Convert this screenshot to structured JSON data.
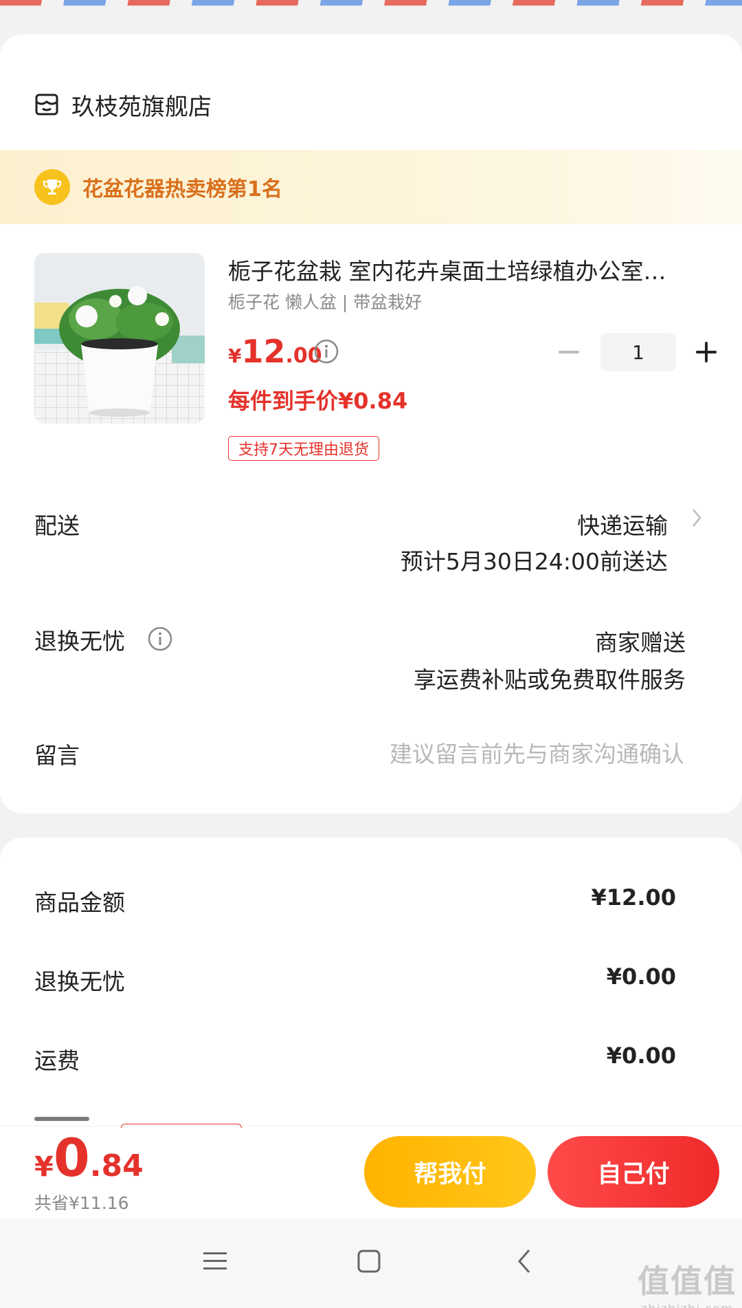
{
  "store": {
    "name": "玖枝苑旗舰店",
    "icon": "store-icon"
  },
  "rank_banner": {
    "text": "花盆花器热卖榜第1名",
    "icon": "trophy-icon"
  },
  "product": {
    "title": "栀子花盆栽 室内花卉桌面土培绿植办公室…",
    "spec": "栀子花 懒人盆 | 带盆栽好",
    "price_currency": "¥",
    "price_int": "12",
    "price_dec": ".00",
    "each_price": "每件到手价¥0.84",
    "return_tag": "支持7天无理由退货",
    "quantity": "1"
  },
  "delivery": {
    "label": "配送",
    "method": "快递运输",
    "eta": "预计5月30日24:00前送达"
  },
  "return_service": {
    "label": "退换无忧",
    "value1": "商家赠送",
    "value2": "享运费补贴或免费取件服务"
  },
  "message": {
    "label": "留言",
    "placeholder": "建议留言前先与商家沟通确认"
  },
  "summary": [
    {
      "label": "商品金额",
      "value": "¥12.00"
    },
    {
      "label": "退换无忧",
      "value": "¥0.00"
    },
    {
      "label": "运费",
      "value": "¥0.00"
    }
  ],
  "footer": {
    "total_currency": "¥",
    "total_int": "0",
    "total_dec": ".84",
    "saved": "共省¥11.16",
    "help_pay": "帮我付",
    "self_pay": "自己付"
  },
  "watermark": {
    "logo": "值值值",
    "url": "zhizhizhi.com"
  },
  "colors": {
    "accent_red": "#e4322b",
    "gold": "#ffb300",
    "rank_orange": "#d9701c"
  }
}
